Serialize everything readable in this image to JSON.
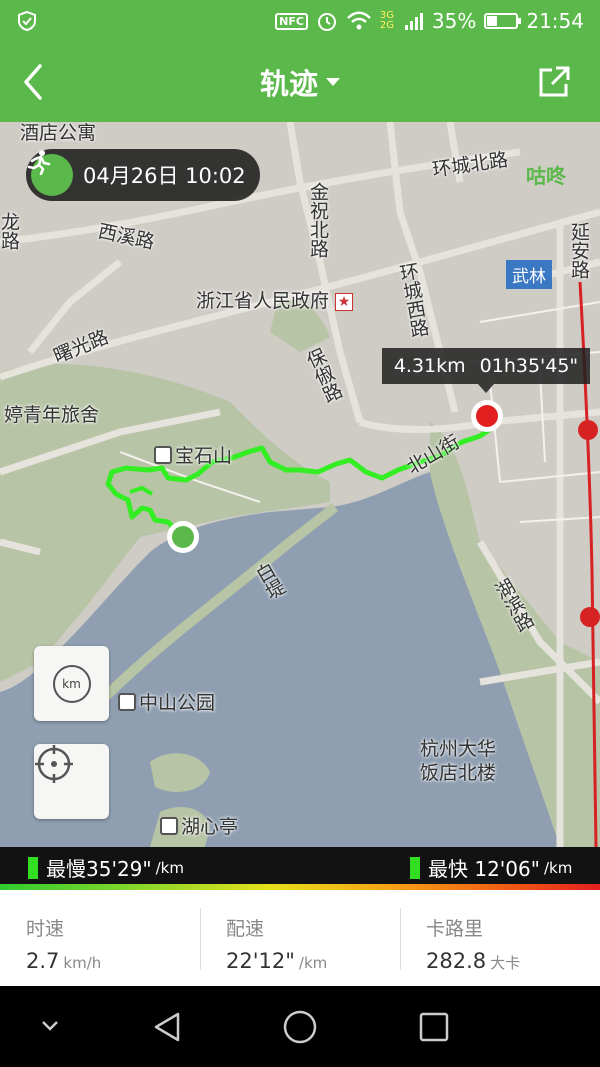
{
  "status_bar": {
    "nfc": "NFC",
    "network": "3G 2G",
    "battery": "35%",
    "battery_level": 0.35,
    "time": "21:54"
  },
  "nav": {
    "title": "轨迹",
    "back_icon": "chevron-left-icon",
    "share_icon": "share-external-icon"
  },
  "map": {
    "time_pill": "04月26日 10:02",
    "track_stat_distance": "4.31km",
    "track_stat_duration": "01h35'45\"",
    "labels": {
      "hotel_top": "酒店公寓",
      "huancheng_north": "环城北路",
      "gudong": "咕咚",
      "xixi": "西溪路",
      "jinzhu": "金祝北路",
      "yanan": "延安路",
      "wulin": "武林",
      "gov": "浙江省人民政府",
      "shuguang": "曙光路",
      "huancheng_west": "环城西路",
      "hostel": "婷青年旅舍",
      "baochu": "保俶路",
      "baoshishan": "宝石山",
      "beishan": "北山街",
      "baiti": "白堤",
      "hubin": "湖滨路",
      "zhongshan": "中山公园",
      "hotel_lake": "杭州大华",
      "hotel_lake_2": "饭店北楼",
      "huxinting": "湖心亭",
      "partial_left": "龙路"
    },
    "zoom_button_label": "km"
  },
  "legend": {
    "slow_label": "最慢35'29\"",
    "fast_label": "最快 12'06\"",
    "unit": "/km"
  },
  "stats": [
    {
      "label": "时速",
      "value": "2.7",
      "unit": "km/h"
    },
    {
      "label": "配速",
      "value": "22'12\"",
      "unit": "/km"
    },
    {
      "label": "卡路里",
      "value": "282.8",
      "unit": "大卡"
    }
  ],
  "colors": {
    "accent": "#5bb84a",
    "track": "#33dd22",
    "start_marker": "#5bb84a",
    "end_marker": "#e21f1f"
  }
}
